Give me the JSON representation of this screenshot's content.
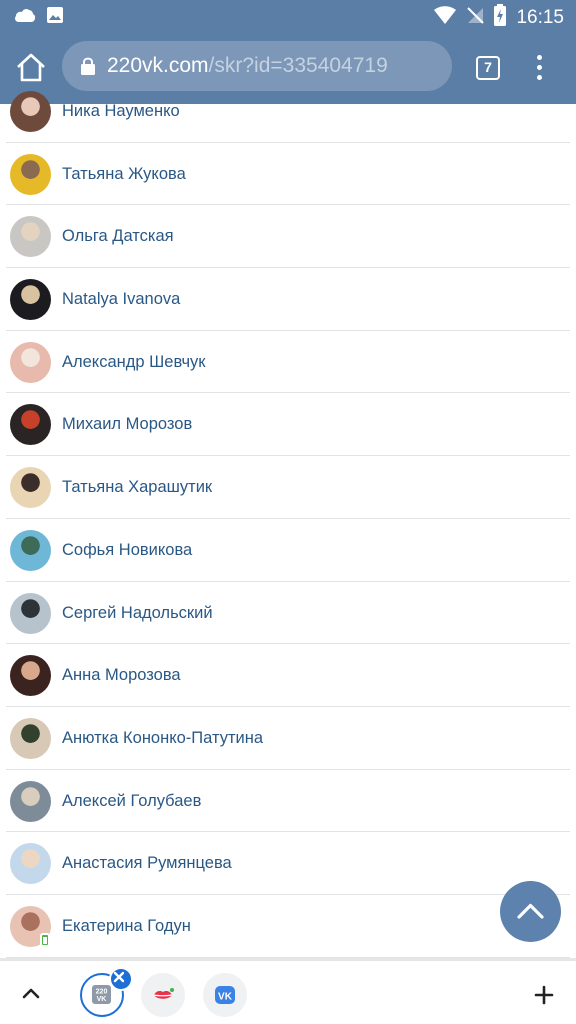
{
  "status_bar": {
    "time": "16:15",
    "icons": [
      "cloud-icon",
      "image-icon",
      "wifi-icon",
      "no-signal-icon",
      "battery-charging-icon"
    ]
  },
  "browser": {
    "url_domain": "220vk.com",
    "url_path": "/skr?id=335404719",
    "tab_count": "7",
    "icons": [
      "home-icon",
      "lock-icon",
      "menu-icon"
    ]
  },
  "list": {
    "items": [
      {
        "name": "Ника Науменко",
        "avatar_colors": [
          "#6e4a3d",
          "#e8c8b8"
        ]
      },
      {
        "name": "Татьяна Жукова",
        "avatar_colors": [
          "#e6b928",
          "#8b6a52"
        ]
      },
      {
        "name": "Ольга Датская",
        "avatar_colors": [
          "#c9c7c4",
          "#e3d3c0"
        ]
      },
      {
        "name": "Natalya Ivanova",
        "avatar_colors": [
          "#1c1b1f",
          "#d9c2a0"
        ]
      },
      {
        "name": "Александр Шевчук",
        "avatar_colors": [
          "#e8b9ad",
          "#f2e5dc"
        ]
      },
      {
        "name": "Михаил Морозов",
        "avatar_colors": [
          "#2b2424",
          "#c7402a"
        ]
      },
      {
        "name": "Татьяна Харашутик",
        "avatar_colors": [
          "#e9d5b4",
          "#3a2d2a"
        ]
      },
      {
        "name": "Софья Новикова",
        "avatar_colors": [
          "#6fb7d6",
          "#3d6b58"
        ]
      },
      {
        "name": "Сергей Надольский",
        "avatar_colors": [
          "#b7c3cc",
          "#2e3338"
        ]
      },
      {
        "name": "Анна Морозова",
        "avatar_colors": [
          "#3b2420",
          "#d8a88c"
        ]
      },
      {
        "name": "Анютка Кононко-Патутина",
        "avatar_colors": [
          "#d8c9b6",
          "#32402e"
        ]
      },
      {
        "name": "Алексей Голубаев",
        "avatar_colors": [
          "#7e8b98",
          "#d9cdbd"
        ]
      },
      {
        "name": "Анастасия Румянцева",
        "avatar_colors": [
          "#c3d8ea",
          "#ebd7c4"
        ]
      },
      {
        "name": "Екатерина Годун",
        "avatar_colors": [
          "#e8c3b4",
          "#a9715e"
        ],
        "online_mobile": true
      }
    ]
  },
  "bottom_bar": {
    "tabs": [
      {
        "name": "220vk-tab",
        "label": "220 VK",
        "active": true
      },
      {
        "name": "lips-tab",
        "label": ""
      },
      {
        "name": "vk-tab",
        "label": "VK"
      }
    ],
    "icons": [
      "chevron-up-icon",
      "close-icon",
      "plus-icon"
    ]
  },
  "colors": {
    "toolbar": "#5b7ea6",
    "link": "#2a5885",
    "accent": "#1d6fd6",
    "fab": "#5c82ad"
  }
}
